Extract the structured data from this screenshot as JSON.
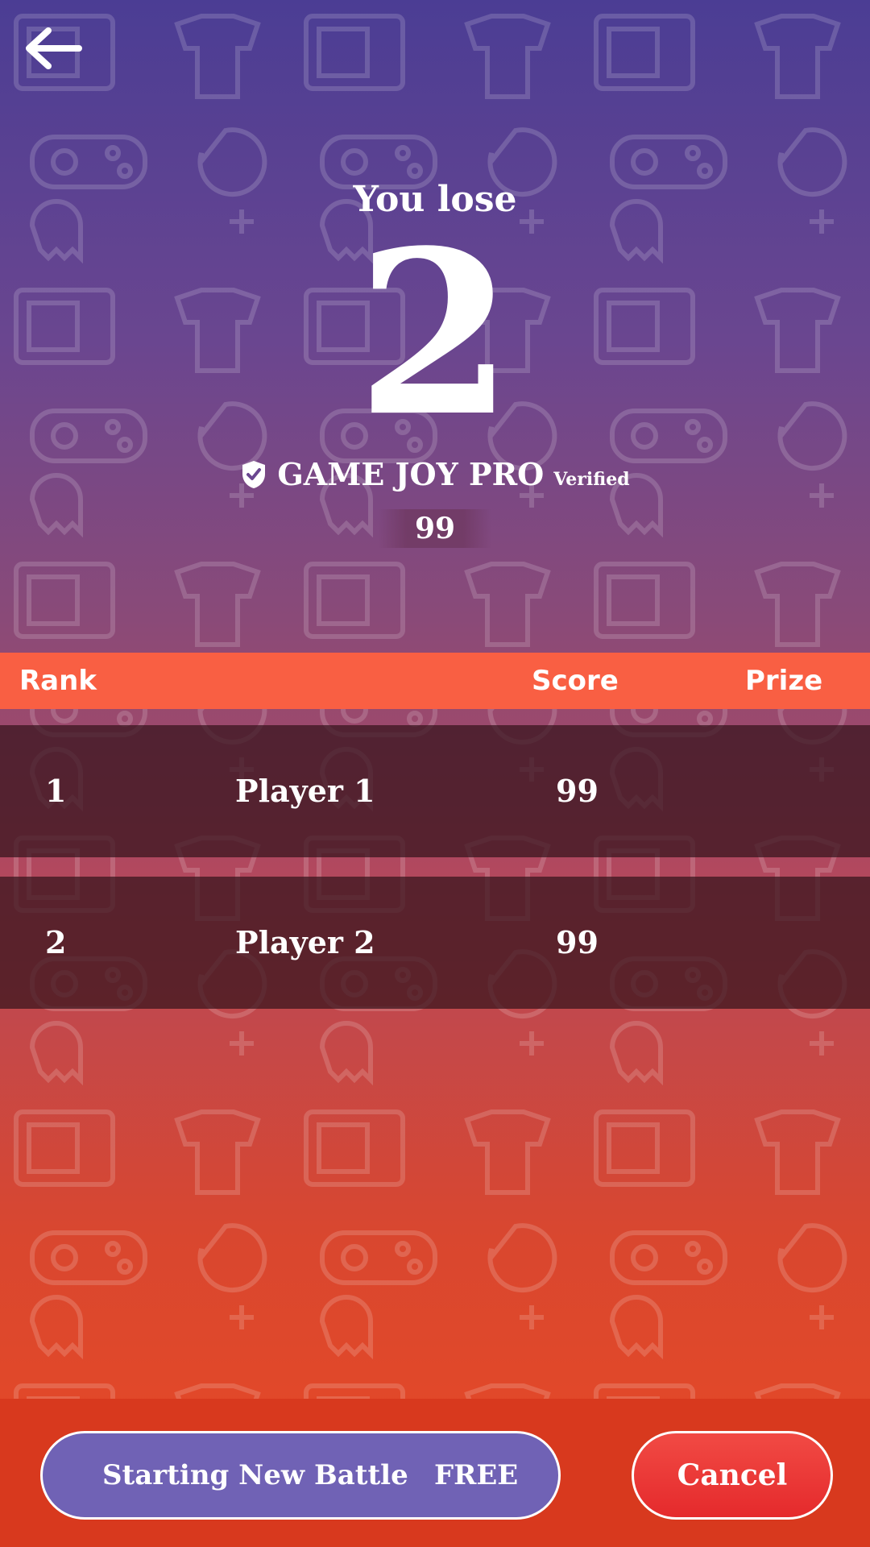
{
  "header": {
    "back_icon": "arrow-left-icon"
  },
  "result": {
    "label": "You lose",
    "rank": "2",
    "user_name": "GAME JOY PRO",
    "verified_label": "Verified",
    "verified_icon": "shield-check-icon",
    "score": "99"
  },
  "leaderboard": {
    "columns": {
      "rank": "Rank",
      "score": "Score",
      "prize": "Prize"
    },
    "rows": [
      {
        "rank": "1",
        "name": "Player 1",
        "score": "99",
        "prize": ""
      },
      {
        "rank": "2",
        "name": "Player 2",
        "score": "99",
        "prize": ""
      }
    ]
  },
  "actions": {
    "new_battle_label": "Starting New Battle",
    "new_battle_price": "FREE",
    "cancel_label": "Cancel"
  },
  "colors": {
    "header_bg": "#f95f43",
    "new_battle_bg": "#7062b5",
    "cancel_bg": "#e52a2c",
    "bottom_bar_bg": "#d8391e"
  }
}
